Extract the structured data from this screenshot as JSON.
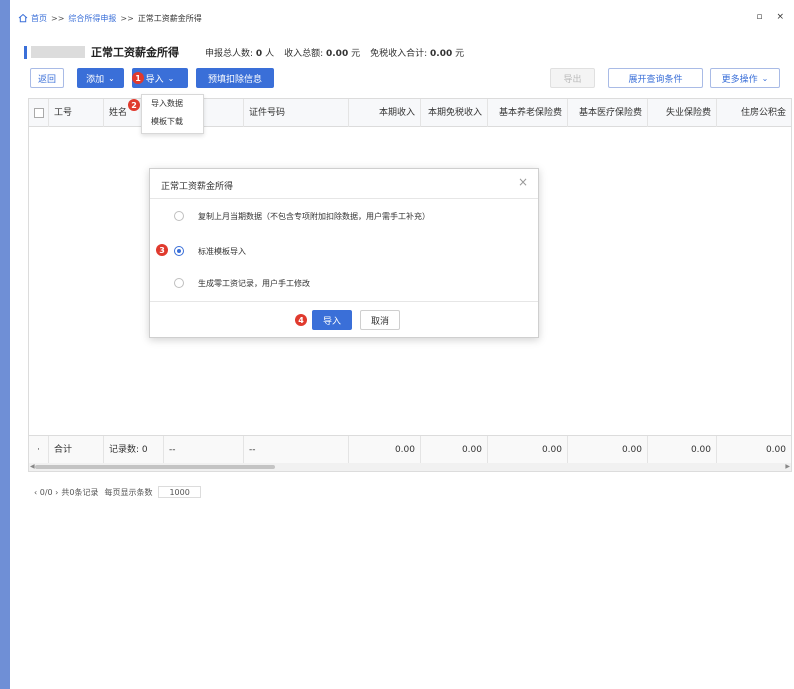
{
  "breadcrumb": {
    "home": "首页",
    "sep": ">>",
    "level1": "综合所得申报",
    "current": "正常工资薪金所得"
  },
  "window_controls": {
    "restore": "▫",
    "close": "×"
  },
  "header": {
    "title": "正常工资薪金所得",
    "total_people_label": "申报总人数:",
    "total_people_value": "0",
    "total_people_unit": "人",
    "income_total_label": "收入总额:",
    "income_total_value": "0.00",
    "income_total_unit": "元",
    "tax_free_total_label": "免税收入合计:",
    "tax_free_total_value": "0.00",
    "tax_free_total_unit": "元"
  },
  "toolbar": {
    "back": "返回",
    "add": "添加",
    "import": "导入",
    "prefill_deduction": "预填扣除信息",
    "export": "导出",
    "expand_query": "展开查询条件",
    "more_actions": "更多操作",
    "caret": "⌄"
  },
  "import_menu": {
    "items": [
      {
        "label": "导入数据"
      },
      {
        "label": "模板下载"
      }
    ]
  },
  "badges": [
    "1",
    "2",
    "3",
    "4"
  ],
  "table": {
    "columns": [
      "工号",
      "姓名",
      "",
      "证件号码",
      "本期收入",
      "本期免税收入",
      "基本养老保险费",
      "基本医疗保险费",
      "失业保险费",
      "住房公积金"
    ],
    "footer": {
      "dot": "·",
      "total_label": "合计",
      "record_count": "记录数: 0",
      "dash1": "--",
      "dash2": "--",
      "values": [
        "0.00",
        "0.00",
        "0.00",
        "0.00",
        "0.00",
        "0.00"
      ]
    }
  },
  "pagination": {
    "nav": "‹ 0/0 ›",
    "total": "共0条记录",
    "per_page_label": "每页显示条数",
    "per_page_value": "1000"
  },
  "modal": {
    "title": "正常工资薪金所得",
    "close": "×",
    "options": [
      {
        "label": "复制上月当期数据（不包含专项附加扣除数据，用户需手工补充）",
        "checked": false
      },
      {
        "label": "标准模板导入",
        "checked": true
      },
      {
        "label": "生成零工资记录，用户手工修改",
        "checked": false
      }
    ],
    "confirm": "导入",
    "cancel": "取消"
  },
  "colors": {
    "primary": "#3a6fd8",
    "badge": "#e03a2e",
    "left_strip": "#6f8fd6"
  }
}
